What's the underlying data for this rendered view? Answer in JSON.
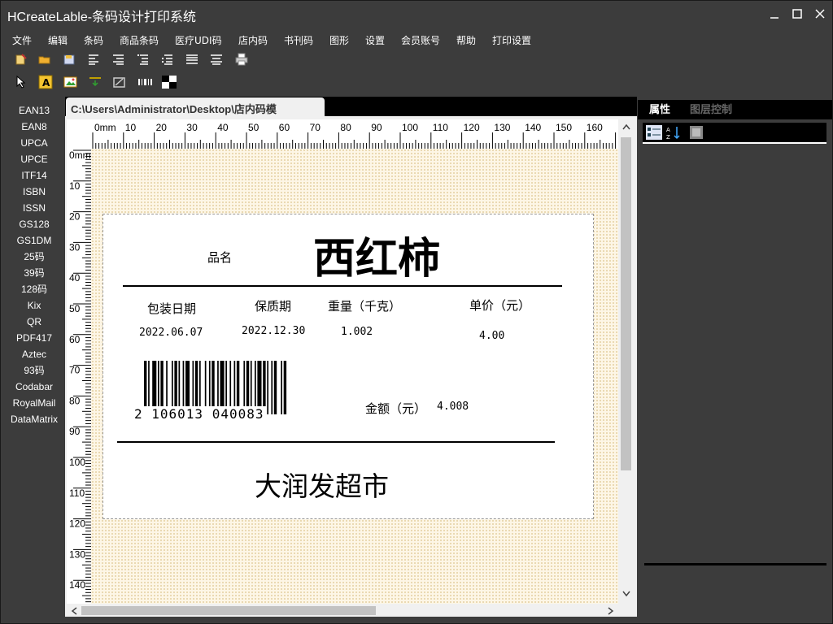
{
  "window": {
    "title": "HCreateLable-条码设计打印系统"
  },
  "menu": [
    "文件",
    "编辑",
    "条码",
    "商品条码",
    "医疗UDI码",
    "店内码",
    "书刊码",
    "图形",
    "设置",
    "会员账号",
    "帮助",
    "打印设置"
  ],
  "toolbar1_icons": [
    "new-icon",
    "open-folder-icon",
    "save-icon",
    "align-left-icon",
    "align-right-icon",
    "align-top-icon",
    "align-bottom-icon",
    "align-center-h-icon",
    "align-center-v-icon",
    "print-icon"
  ],
  "toolbar2_icons": [
    "pointer-icon",
    "text-icon",
    "image-icon",
    "line-icon",
    "shape-icon",
    "barcode-icon",
    "qrcode-icon"
  ],
  "barcode_types": [
    "EAN13",
    "EAN8",
    "UPCA",
    "UPCE",
    "ITF14",
    "ISBN",
    "ISSN",
    "GS128",
    "GS1DM",
    "25码",
    "39码",
    "128码",
    "Kix",
    "QR",
    "PDF417",
    "Aztec",
    "93码",
    "Codabar",
    "RoyalMail",
    "DataMatrix"
  ],
  "document": {
    "tab_title": "C:\\Users\\Administrator\\Desktop\\店内码模"
  },
  "ruler": {
    "h_labels": [
      "0mm",
      "10",
      "20",
      "30",
      "40",
      "50",
      "60",
      "70",
      "80",
      "90",
      "100",
      "110",
      "120",
      "130",
      "140",
      "150",
      "160"
    ],
    "v_labels": [
      "0mm",
      "10",
      "20",
      "30",
      "40",
      "50",
      "60",
      "70",
      "80",
      "90",
      "100",
      "110",
      "120",
      "130",
      "140"
    ]
  },
  "label": {
    "name_caption": "品名",
    "product_name": "西红柿",
    "pack_date_caption": "包装日期",
    "shelf_life_caption": "保质期",
    "weight_caption": "重量（千克）",
    "unit_price_caption": "单价（元）",
    "pack_date": "2022.06.07",
    "shelf_life": "2022.12.30",
    "weight": "1.002",
    "unit_price": "4.00",
    "barcode_digits": "2  106013  040083",
    "amount_caption": "金额（元）",
    "amount": "4.008",
    "store_name": "大润发超市"
  },
  "right_panel": {
    "tab_properties": "属性",
    "tab_layers": "图层控制",
    "icons": [
      "categorized-icon",
      "sort-az-icon",
      "property-pages-icon"
    ]
  },
  "colors": {
    "chrome": "#3c3c3c",
    "grid_bg": "#fdf6e6",
    "accent_text": "#ffffff"
  }
}
